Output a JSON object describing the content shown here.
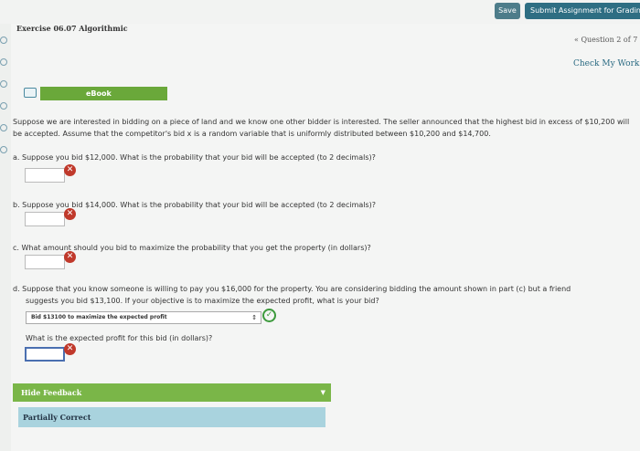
{
  "toolbar": {
    "save_label": "Save",
    "submit_label": "Submit Assignment for Grading"
  },
  "exercise": {
    "title": "Exercise 06.07 Algorithmic",
    "question_nav": "« Question 2 of 7",
    "check_work_label": "Check My Work"
  },
  "ebook": {
    "label": "eBook"
  },
  "problem": {
    "intro": "Suppose we are interested in bidding on a piece of land and we know one other bidder is interested. The seller announced that the highest bid in excess of $10,200 will be accepted. Assume that the competitor's bid x is a random variable that is uniformly distributed between $10,200 and $14,700."
  },
  "questions": {
    "a": "a.  Suppose you bid $12,000. What is the probability that your bid will be accepted (to 2 decimals)?",
    "b": "b.  Suppose you bid $14,000. What is the probability that your bid will be accepted (to 2 decimals)?",
    "c": "c.  What amount should you bid to maximize the probability that you get the property (in dollars)?",
    "d_line1": "d.  Suppose that you know someone is willing to pay you $16,000 for the property. You are considering bidding the amount shown in part (c) but a friend",
    "d_line2": "suggests you bid $13,100. If your objective is to maximize the expected profit, what is your bid?",
    "d_select_value": "Bid $13100 to maximize the expected profit",
    "d_followup": "What is the expected profit for this bid (in dollars)?"
  },
  "feedback": {
    "header_label": "Hide Feedback",
    "status_label": "Partially Correct"
  },
  "icons": {
    "incorrect": "✕",
    "correct": "✓",
    "select_arrow": "↕",
    "caret": "▼"
  },
  "colors": {
    "ebook_green": "#6aa83a",
    "submit_blue": "#2e6e83",
    "incorrect_red": "#c0392b",
    "correct_green": "#3c9a3c",
    "feedback_body": "#a9d3de"
  }
}
